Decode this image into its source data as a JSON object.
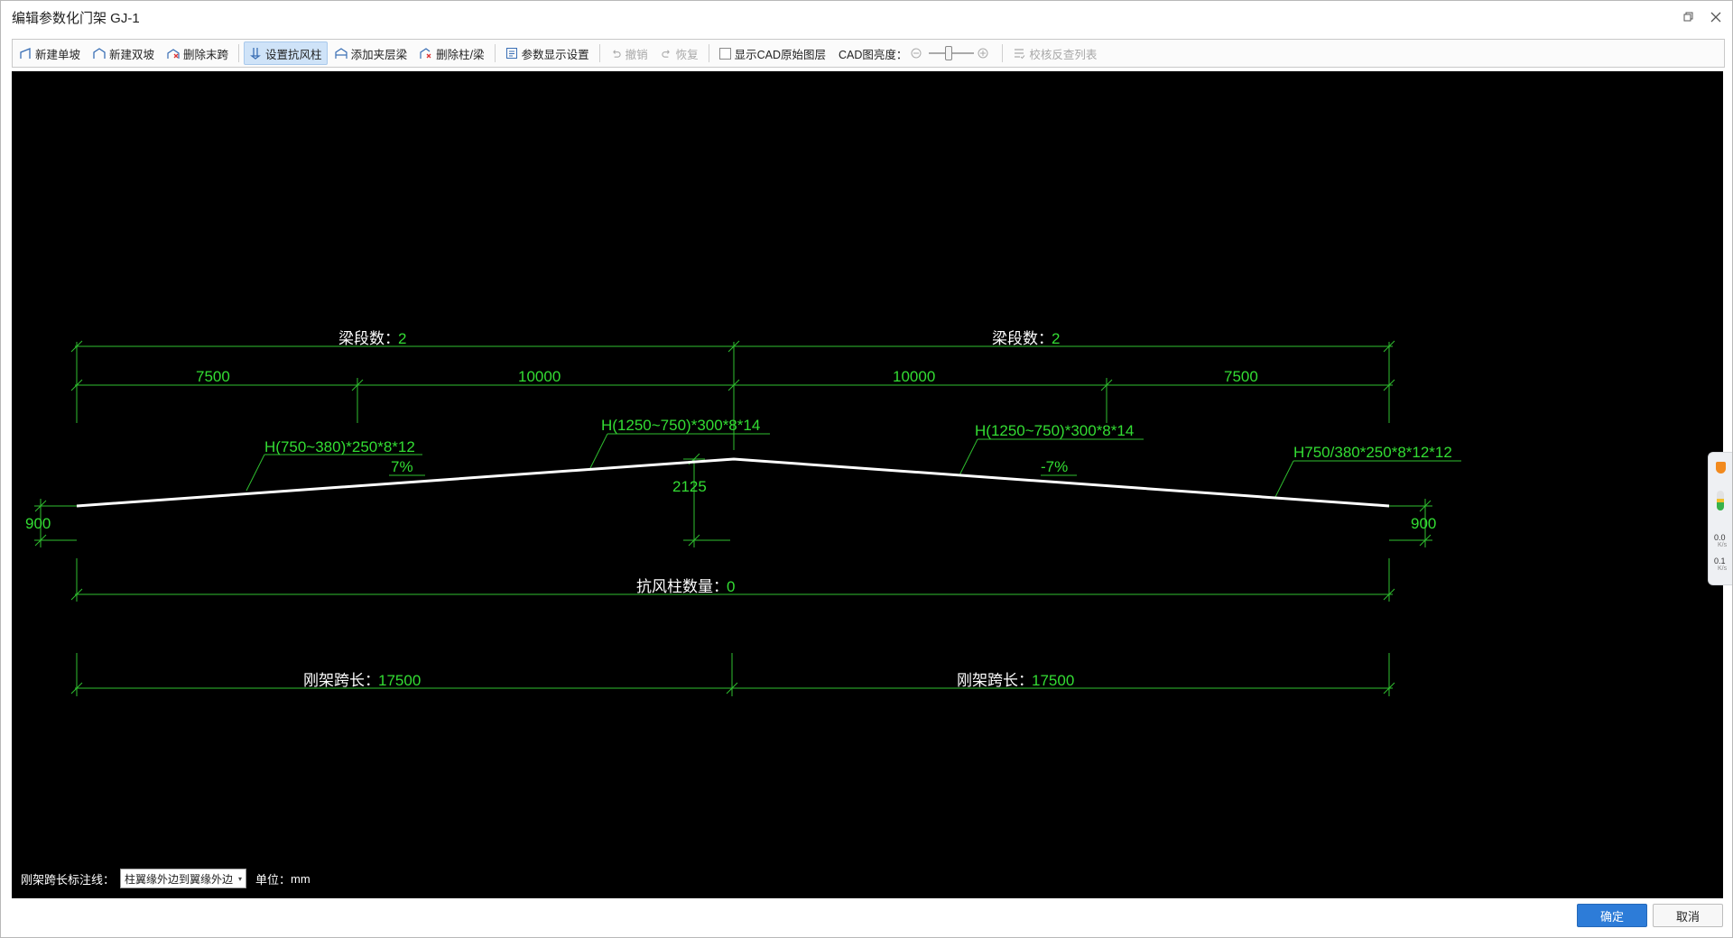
{
  "window": {
    "title": "编辑参数化门架 GJ-1"
  },
  "toolbar": {
    "new_single_slope": "新建单坡",
    "new_double_slope": "新建双坡",
    "delete_end_span": "删除末跨",
    "set_wind_column": "设置抗风柱",
    "add_mezzanine_beam": "添加夹层梁",
    "delete_column_beam": "删除柱/梁",
    "param_display_settings": "参数显示设置",
    "undo": "撤销",
    "redo": "恢复",
    "show_cad_layers": "显示CAD原始图层",
    "cad_brightness": "CAD图亮度：",
    "check_reverse_list": "校核反查列表"
  },
  "drawing": {
    "left_segment_label": "梁段数：",
    "left_segment_value": "2",
    "right_segment_label": "梁段数：",
    "right_segment_value": "2",
    "dims_top": [
      "7500",
      "10000",
      "10000",
      "7500"
    ],
    "beam_label_1": "H(750~380)*250*8*12",
    "beam_label_2": "H(1250~750)*300*8*14",
    "beam_label_3": "H(1250~750)*300*8*14",
    "beam_label_4": "H750/380*250*8*12*12",
    "slope_left": "7%",
    "slope_right": "-7%",
    "ridge_height": "2125",
    "left_col_height": "900",
    "right_col_height": "900",
    "wind_column_label": "抗风柱数量：",
    "wind_column_value": "0",
    "span_left_label": "刚架跨长：",
    "span_left_value": "17500",
    "span_right_label": "刚架跨长：",
    "span_right_value": "17500"
  },
  "bottom": {
    "annotation_label": "刚架跨长标注线：",
    "annotation_select": "柱翼缘外边到翼缘外边",
    "unit_label": "单位：",
    "unit_value": "mm"
  },
  "side_widget": {
    "upload": "0.0",
    "upload_unit": "K/s",
    "download": "0.1",
    "download_unit": "K/s"
  },
  "buttons": {
    "ok": "确定",
    "cancel": "取消"
  },
  "colors": {
    "canvas_bg": "#000000",
    "dim_green": "#33dd33",
    "frame_white": "#ffffff",
    "primary_button": "#2d7cd8"
  }
}
